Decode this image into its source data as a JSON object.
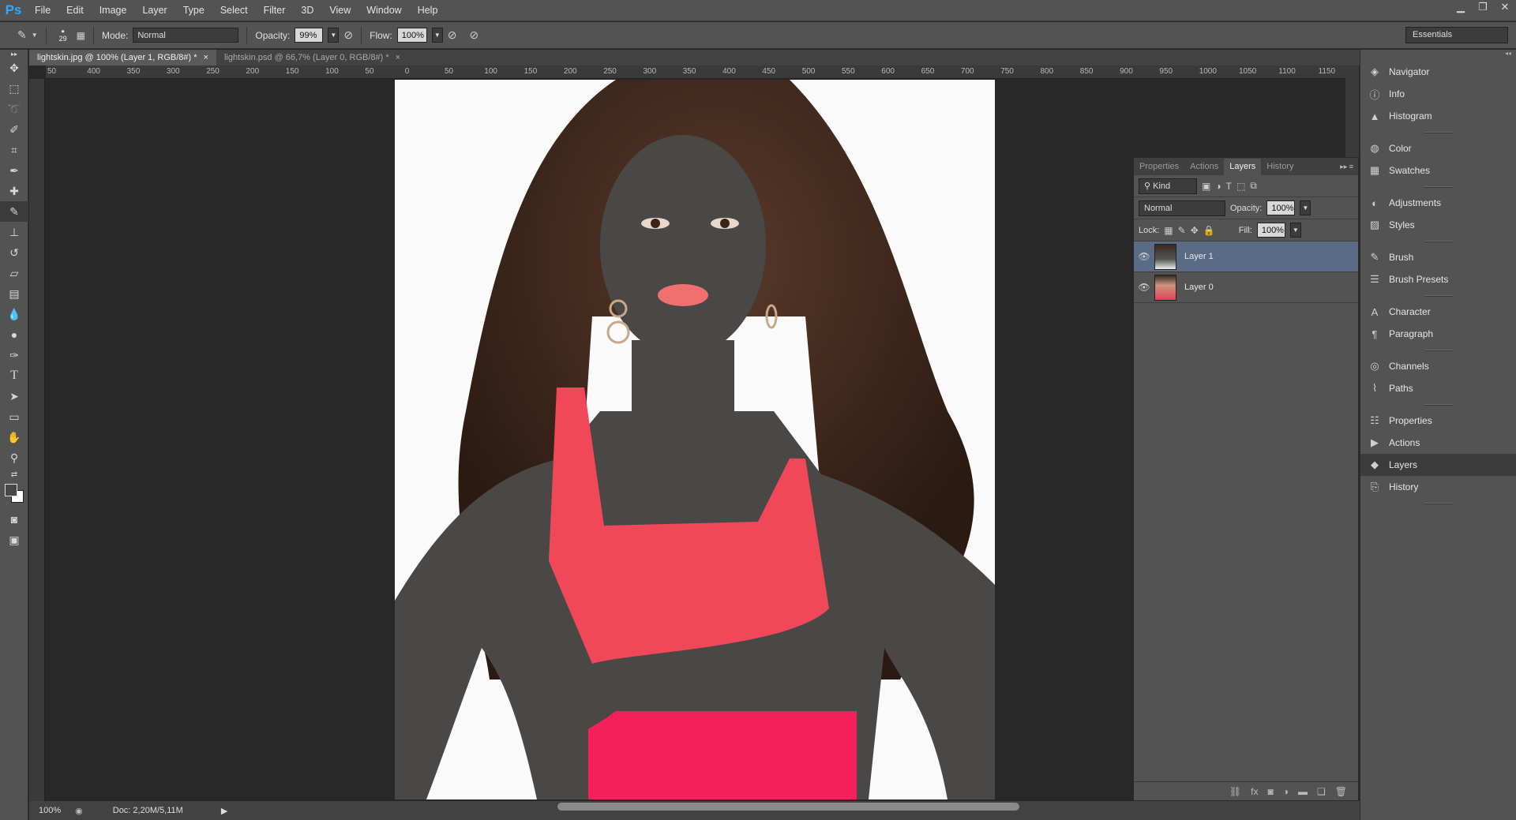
{
  "app": {
    "logo": "Ps"
  },
  "menu": [
    "File",
    "Edit",
    "Image",
    "Layer",
    "Type",
    "Select",
    "Filter",
    "3D",
    "View",
    "Window",
    "Help"
  ],
  "options": {
    "brush_size": "29",
    "mode_label": "Mode:",
    "mode_value": "Normal",
    "opacity_label": "Opacity:",
    "opacity_value": "99%",
    "flow_label": "Flow:",
    "flow_value": "100%",
    "workspace": "Essentials"
  },
  "tabs": [
    {
      "label": "lightskin.jpg @ 100% (Layer 1, RGB/8#) *",
      "close": "×"
    },
    {
      "label": "lightskin.psd @ 66,7% (Layer 0, RGB/8#) *",
      "close": "×"
    }
  ],
  "ruler_h": [
    "50",
    "400",
    "350",
    "300",
    "250",
    "200",
    "150",
    "100",
    "50",
    "0",
    "50",
    "100",
    "150",
    "200",
    "250",
    "300",
    "350",
    "400",
    "450",
    "500",
    "550",
    "600",
    "650",
    "700",
    "750",
    "800",
    "850",
    "900",
    "950",
    "1000",
    "1050",
    "1100",
    "1150"
  ],
  "status": {
    "zoom": "100%",
    "doc": "Doc: 2,20M/5,11M"
  },
  "layers_panel": {
    "tabs": [
      "Properties",
      "Actions",
      "Layers",
      "History"
    ],
    "kind": "Kind",
    "blend": "Normal",
    "opacity_label": "Opacity:",
    "opacity_value": "100%",
    "lock_label": "Lock:",
    "fill_label": "Fill:",
    "fill_value": "100%",
    "layers": [
      {
        "name": "Layer 1",
        "selected": true
      },
      {
        "name": "Layer 0",
        "selected": false
      }
    ],
    "footer_icons": [
      "link-icon",
      "fx-icon",
      "mask-icon",
      "adjustment-icon",
      "folder-icon",
      "new-layer-icon",
      "trash-icon"
    ]
  },
  "dock": {
    "groups": [
      [
        {
          "label": "Navigator",
          "icon": "navigator-icon"
        },
        {
          "label": "Info",
          "icon": "info-icon"
        },
        {
          "label": "Histogram",
          "icon": "histogram-icon"
        }
      ],
      [
        {
          "label": "Color",
          "icon": "color-icon"
        },
        {
          "label": "Swatches",
          "icon": "swatches-icon"
        }
      ],
      [
        {
          "label": "Adjustments",
          "icon": "adjustments-icon"
        },
        {
          "label": "Styles",
          "icon": "styles-icon"
        }
      ],
      [
        {
          "label": "Brush",
          "icon": "brush-icon"
        },
        {
          "label": "Brush Presets",
          "icon": "brush-presets-icon"
        }
      ],
      [
        {
          "label": "Character",
          "icon": "character-icon"
        },
        {
          "label": "Paragraph",
          "icon": "paragraph-icon"
        }
      ],
      [
        {
          "label": "Channels",
          "icon": "channels-icon"
        },
        {
          "label": "Paths",
          "icon": "paths-icon"
        }
      ],
      [
        {
          "label": "Properties",
          "icon": "properties-icon"
        },
        {
          "label": "Actions",
          "icon": "actions-icon"
        },
        {
          "label": "Layers",
          "icon": "layers-icon",
          "active": true
        },
        {
          "label": "History",
          "icon": "history-icon"
        }
      ]
    ]
  }
}
